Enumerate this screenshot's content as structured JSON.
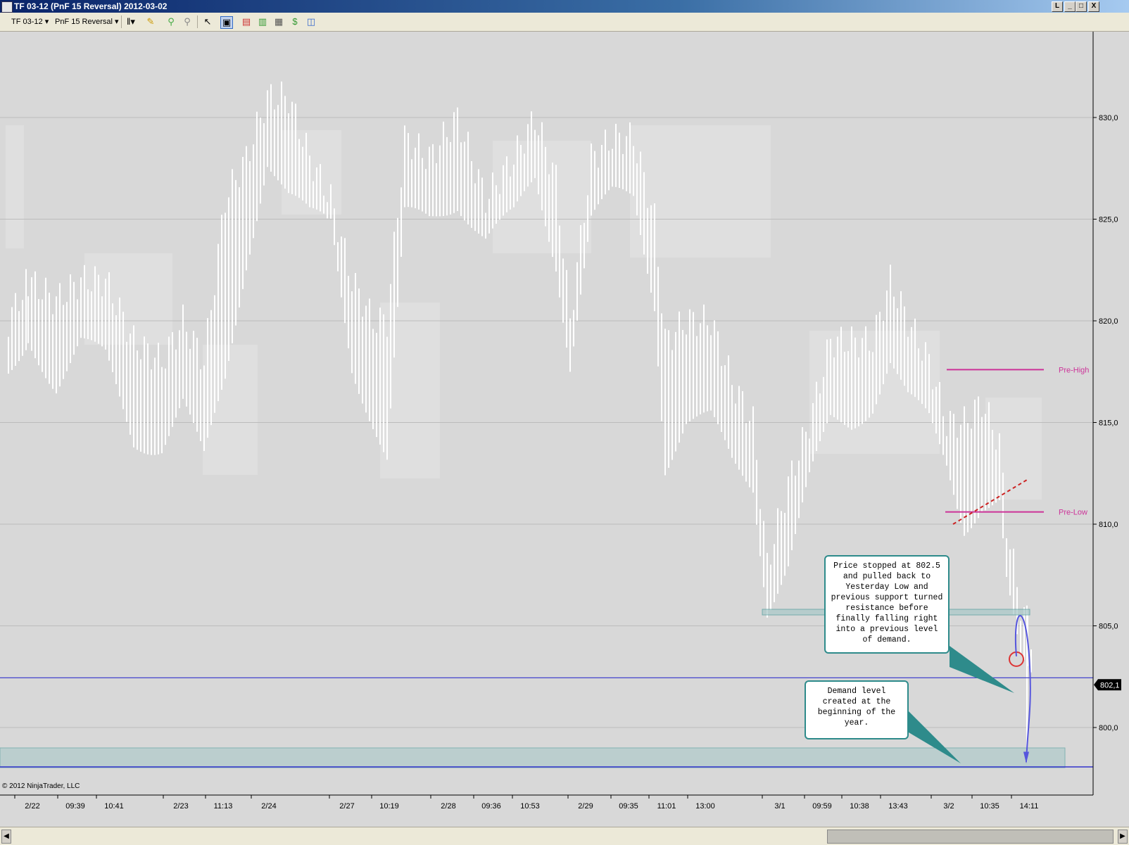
{
  "window": {
    "title": "TF 03-12 (PnF 15 Reversal)  2012-03-02",
    "buttons": [
      "L",
      "_",
      "□",
      "X"
    ]
  },
  "toolbar": {
    "instrument": "TF 03-12",
    "period": "PnF 15 Reversal"
  },
  "chart": {
    "copyright": "© 2012 NinjaTrader, LLC",
    "price_labels": [
      "830,0",
      "825,0",
      "820,0",
      "815,0",
      "810,0",
      "805,0",
      "800,0"
    ],
    "current_price": "802,1",
    "time_labels": [
      "2/22",
      "09:39",
      "10:41",
      "2/23",
      "11:13",
      "2/24",
      "2/27",
      "10:19",
      "2/28",
      "09:36",
      "10:53",
      "2/29",
      "09:35",
      "11:01",
      "13:00",
      "3/1",
      "09:59",
      "10:38",
      "13:43",
      "3/2",
      "10:35",
      "14:11"
    ],
    "pre_high_label": "Pre-High",
    "pre_low_label": "Pre-Low",
    "colors": {
      "background": "#d8d8d8",
      "bars": "#ffffff",
      "pre_lines": "#cc3399",
      "blue_line": "#3333cc",
      "zone": "#a8c8c8"
    }
  },
  "chart_data": {
    "type": "pnf-range-bars",
    "ylim": [
      798,
      833
    ],
    "y_ticks": [
      800,
      805,
      810,
      815,
      820,
      825,
      830
    ],
    "pre_high": 817.6,
    "pre_low": 810.6,
    "current_price": 802.1
  },
  "callouts": {
    "c1_lines": [
      "Price stopped at 802.5",
      "and pulled back to",
      "Yesterday Low and",
      "previous support turned",
      "resistance before",
      "finally falling right",
      "into a previous level",
      "of demand."
    ],
    "c2_lines": [
      "Demand level",
      "created at the",
      "beginning of the",
      "year."
    ]
  }
}
